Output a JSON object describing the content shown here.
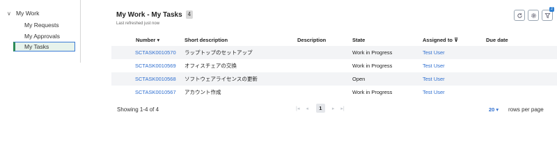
{
  "nav": {
    "root_label": "My Work",
    "items": [
      {
        "label": "My Requests"
      },
      {
        "label": "My Approvals"
      },
      {
        "label": "My Tasks"
      }
    ]
  },
  "header": {
    "title": "My Work - My Tasks",
    "count": "4",
    "refreshed": "Last refreshed just now",
    "filter_count": "2"
  },
  "table": {
    "columns": {
      "number": "Number",
      "number_sort": "▾",
      "short_description": "Short description",
      "description": "Description",
      "state": "State",
      "assigned_to": "Assigned to",
      "assigned_filter": "⊽",
      "due_date": "Due date"
    },
    "rows": [
      {
        "number": "SCTASK0010570",
        "short_description": "ラップトップのセットアップ",
        "description": "",
        "state": "Work in Progress",
        "assigned_to": "Test User",
        "due_date": ""
      },
      {
        "number": "SCTASK0010569",
        "short_description": "オフィスチェアの交換",
        "description": "",
        "state": "Work in Progress",
        "assigned_to": "Test User",
        "due_date": ""
      },
      {
        "number": "SCTASK0010568",
        "short_description": "ソフトウェアライセンスの更新",
        "description": "",
        "state": "Open",
        "assigned_to": "Test User",
        "due_date": ""
      },
      {
        "number": "SCTASK0010567",
        "short_description": "アカウント作成",
        "description": "",
        "state": "Work in Progress",
        "assigned_to": "Test User",
        "due_date": ""
      }
    ]
  },
  "footer": {
    "showing": "Showing 1-4 of 4",
    "pagination": {
      "first": "|◂",
      "prev": "◂",
      "current": "1",
      "next": "▸",
      "last": "▸|"
    },
    "rows_per_page_value": "20 ▾",
    "rows_per_page_label": "rows per page"
  },
  "colors": {
    "link": "#2f6fd0",
    "selected_border": "#2e8b57",
    "badge": "#2f7fd1"
  }
}
